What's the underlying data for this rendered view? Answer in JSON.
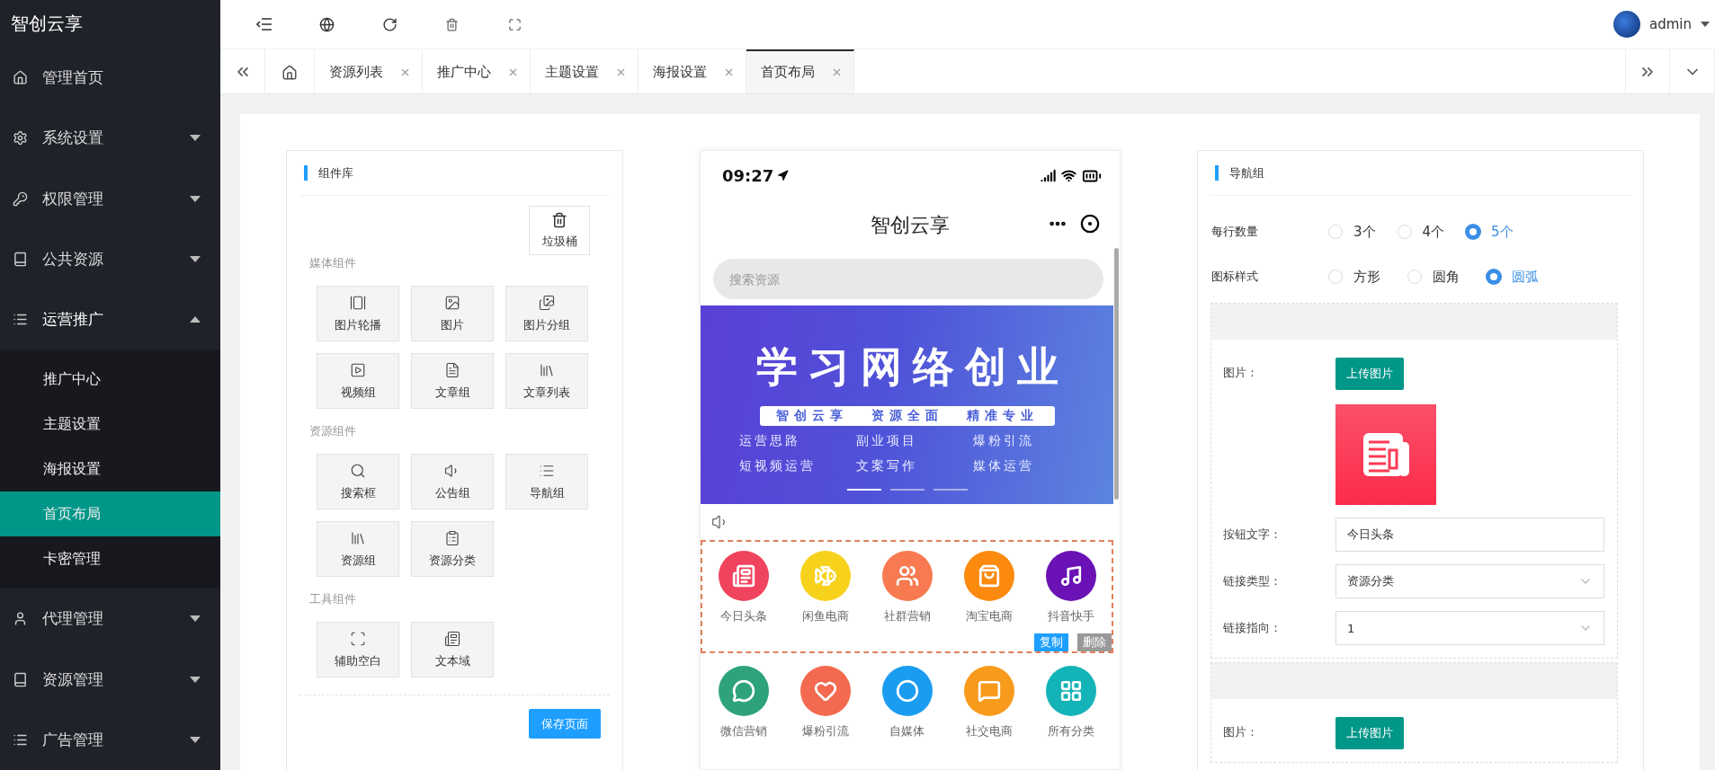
{
  "brand": "智创云享",
  "sidebar": {
    "items": [
      {
        "label": "管理首页",
        "kind": "home"
      },
      {
        "label": "系统设置",
        "kind": "gear",
        "expanded": false
      },
      {
        "label": "权限管理",
        "kind": "key",
        "expanded": false
      },
      {
        "label": "公共资源",
        "kind": "book",
        "expanded": false
      },
      {
        "label": "运营推广",
        "kind": "list",
        "expanded": true,
        "children": [
          {
            "label": "推广中心",
            "selected": false
          },
          {
            "label": "主题设置",
            "selected": false
          },
          {
            "label": "海报设置",
            "selected": false
          },
          {
            "label": "首页布局",
            "selected": true
          },
          {
            "label": "卡密管理",
            "selected": false
          }
        ]
      },
      {
        "label": "代理管理",
        "kind": "user",
        "expanded": false
      },
      {
        "label": "资源管理",
        "kind": "book",
        "expanded": false
      },
      {
        "label": "广告管理",
        "kind": "list",
        "expanded": false
      }
    ]
  },
  "user": {
    "name": "admin"
  },
  "tabs": [
    {
      "kind": "home",
      "selected": false
    },
    {
      "kind": "page",
      "label": "资源列表",
      "selected": false
    },
    {
      "kind": "page",
      "label": "推广中心",
      "selected": false
    },
    {
      "kind": "page",
      "label": "主题设置",
      "selected": false
    },
    {
      "kind": "page",
      "label": "海报设置",
      "selected": false
    },
    {
      "kind": "page",
      "label": "首页布局",
      "selected": true
    }
  ],
  "library": {
    "title": "组件库",
    "trash": "垃圾桶",
    "save_button": "保存页面",
    "groups": [
      {
        "title": "媒体组件",
        "items": [
          {
            "label": "图片轮播",
            "kind": "carousel"
          },
          {
            "label": "图片",
            "kind": "image"
          },
          {
            "label": "图片分组",
            "kind": "images"
          },
          {
            "label": "视频组",
            "kind": "video"
          },
          {
            "label": "文章组",
            "kind": "doc"
          },
          {
            "label": "文章列表",
            "kind": "library"
          }
        ]
      },
      {
        "title": "资源组件",
        "items": [
          {
            "label": "搜索框",
            "kind": "search"
          },
          {
            "label": "公告组",
            "kind": "speaker"
          },
          {
            "label": "导航组",
            "kind": "list"
          },
          {
            "label": "资源组",
            "kind": "library"
          },
          {
            "label": "资源分类",
            "kind": "clipboard"
          }
        ]
      },
      {
        "title": "工具组件",
        "items": [
          {
            "label": "辅助空白",
            "kind": "blank"
          },
          {
            "label": "文本域",
            "kind": "text"
          }
        ]
      }
    ]
  },
  "phone": {
    "time": "09:27",
    "title": "智创云享",
    "search_placeholder": "搜索资源",
    "banner": {
      "headline": "学习网络创业",
      "taglines": [
        "智创云享",
        "资源全面",
        "精准专业"
      ],
      "tags": [
        "运营思路",
        "副业项目",
        "爆粉引流",
        "短视频运营",
        "文案写作",
        "媒体运营"
      ],
      "dots": [
        {
          "selected": true
        },
        {
          "selected": false
        },
        {
          "selected": false
        }
      ]
    },
    "copy_button": "复制",
    "delete_button": "删除",
    "nav_rows": [
      {
        "selected": true,
        "items": [
          {
            "label": "今日头条",
            "kind": "news",
            "color": "#f0435d"
          },
          {
            "label": "闲鱼电商",
            "kind": "fish",
            "color": "#f7d21c"
          },
          {
            "label": "社群营销",
            "kind": "users",
            "color": "#f77a50"
          },
          {
            "label": "淘宝电商",
            "kind": "bag",
            "color": "#fb8a0e"
          },
          {
            "label": "抖音快手",
            "kind": "music",
            "color": "#6a12b5"
          }
        ]
      },
      {
        "selected": false,
        "items": [
          {
            "label": "微信营销",
            "kind": "chat",
            "color": "#2ea37a"
          },
          {
            "label": "爆粉引流",
            "kind": "heart",
            "color": "#f46a50"
          },
          {
            "label": "自媒体",
            "kind": "ring",
            "color": "#1a9cf0"
          },
          {
            "label": "社交电商",
            "kind": "bubble",
            "color": "#f89a1c"
          },
          {
            "label": "所有分类",
            "kind": "grid",
            "color": "#14b3b8"
          }
        ]
      }
    ]
  },
  "settings": {
    "title": "导航组",
    "options": [
      {
        "label": "每行数量",
        "choices": [
          {
            "label": "3个",
            "selected": false
          },
          {
            "label": "4个",
            "selected": false
          },
          {
            "label": "5个",
            "selected": true
          }
        ]
      },
      {
        "label": "图标样式",
        "choices": [
          {
            "label": "方形",
            "selected": false
          },
          {
            "label": "圆角",
            "selected": false
          },
          {
            "label": "圆弧",
            "selected": true
          }
        ]
      }
    ],
    "entries": [
      {
        "image_label": "图片：",
        "upload": "上传图片",
        "has_image": true,
        "fields": [
          {
            "kind": "text",
            "label": "按钮文字：",
            "value": "今日头条"
          },
          {
            "kind": "select",
            "label": "链接类型：",
            "value": "资源分类"
          },
          {
            "kind": "select",
            "label": "链接指向：",
            "value": "1"
          }
        ]
      },
      {
        "image_label": "图片：",
        "upload": "上传图片",
        "has_image": false
      }
    ]
  }
}
